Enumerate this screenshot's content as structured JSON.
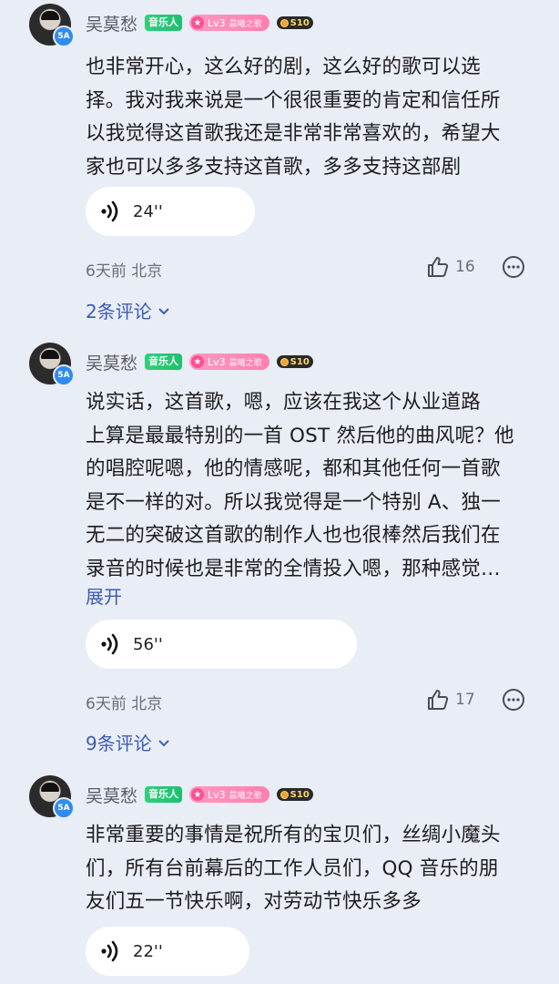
{
  "comments": [
    {
      "user": "吴莫愁",
      "avatar_badge": "5A",
      "badges": {
        "music": "音乐人",
        "level": "Lv3",
        "level_sub": "晨曦之歌",
        "vip": "S10"
      },
      "text": "也非常开心，这么好的剧，这么好的歌可以选\n择。我对我来说是一个很很重要的肯定和信任所\n以我觉得这首歌我还是非常非常喜欢的，希望大\n家也可以多多支持这首歌，多多支持这部剧",
      "expand": "",
      "voice_duration": "24''",
      "time_location": "6天前 北京",
      "likes": "16",
      "replies": "2条评论"
    },
    {
      "user": "吴莫愁",
      "avatar_badge": "5A",
      "badges": {
        "music": "音乐人",
        "level": "Lv3",
        "level_sub": "晨曦之歌",
        "vip": "S10"
      },
      "text": "说实话，这首歌，嗯，应该在我这个从业道路\n上算是最最特别的一首 OST 然后他的曲风呢？他\n的唱腔呢嗯，他的情感呢，都和其他任何一首歌\n是不一样的对。所以我觉得是一个特别 A、独一\n无二的突破这首歌的制作人也也很棒然后我们在\n录音的时候也是非常的全情投入嗯，那种感觉…",
      "expand": "展开",
      "voice_duration": "56''",
      "time_location": "6天前 北京",
      "likes": "17",
      "replies": "9条评论"
    },
    {
      "user": "吴莫愁",
      "avatar_badge": "5A",
      "badges": {
        "music": "音乐人",
        "level": "Lv3",
        "level_sub": "晨曦之歌",
        "vip": "S10"
      },
      "text": "非常重要的事情是祝所有的宝贝们，丝绸小魔头\n们，所有台前幕后的工作人员们，QQ 音乐的朋\n友们五一节快乐啊，对劳动节快乐多多",
      "expand": "",
      "voice_duration": "22''",
      "time_location": "",
      "likes": "",
      "replies": ""
    }
  ],
  "icons": {
    "voice": "voice-wave-icon",
    "like": "thumbs-up-icon",
    "more": "more-dots-icon",
    "chevron": "chevron-down-icon"
  },
  "colors": {
    "background": "#e9edf5",
    "link": "#3d5bb5",
    "music_badge": "#2fd07a",
    "level_badge": "#ff7fae"
  }
}
